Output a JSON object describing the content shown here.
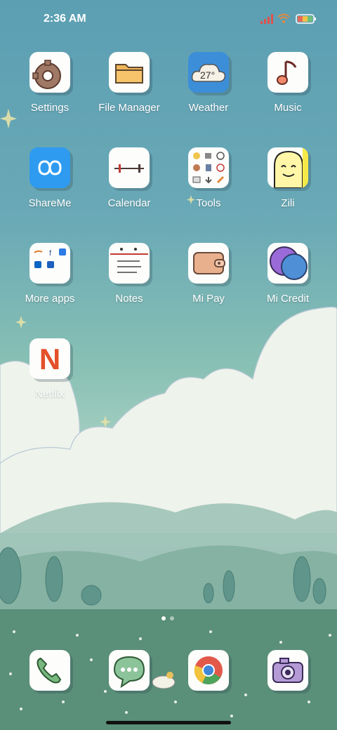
{
  "status_bar": {
    "time": "2:36 AM",
    "signal_icon": "cellular-signal-icon",
    "wifi_icon": "wifi-icon",
    "battery_icon": "battery-icon"
  },
  "apps": [
    {
      "label": "Settings",
      "icon": "gear-icon"
    },
    {
      "label": "File Manager",
      "icon": "folder-icon"
    },
    {
      "label": "Weather",
      "icon": "cloud-icon",
      "temperature": "27°"
    },
    {
      "label": "Music",
      "icon": "music-note-icon"
    },
    {
      "label": "ShareMe",
      "icon": "infinity-icon"
    },
    {
      "label": "Calendar",
      "icon": "calendar-icon"
    },
    {
      "label": "Tools",
      "icon": "tools-folder-icon"
    },
    {
      "label": "Zili",
      "icon": "zili-face-icon"
    },
    {
      "label": "More apps",
      "icon": "apps-folder-icon"
    },
    {
      "label": "Notes",
      "icon": "notes-icon"
    },
    {
      "label": "Mi Pay",
      "icon": "wallet-icon"
    },
    {
      "label": "Mi Credit",
      "icon": "credit-icon"
    },
    {
      "label": "Netflix",
      "icon": "netflix-icon",
      "glyph": "N"
    }
  ],
  "dock": [
    {
      "name": "phone",
      "icon": "phone-icon"
    },
    {
      "name": "messages",
      "icon": "chat-bubble-icon"
    },
    {
      "name": "browser",
      "icon": "chrome-icon"
    },
    {
      "name": "camera",
      "icon": "camera-icon"
    }
  ],
  "page_indicator": {
    "pages": 2,
    "current": 1
  },
  "colors": {
    "sky_top": "#5c9fb3",
    "sky_mid": "#88c0b4",
    "grass": "#5f8f7b",
    "icon_bg": "#fdfdfb",
    "label": "#ffffff"
  }
}
